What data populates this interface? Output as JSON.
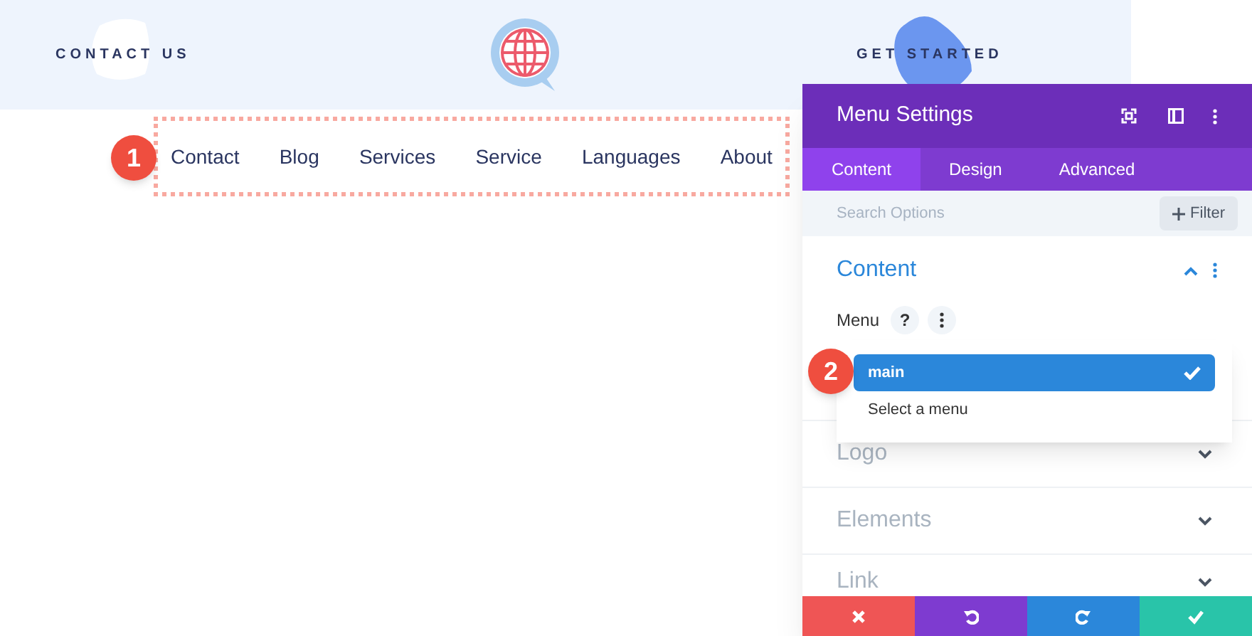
{
  "header": {
    "left_link": "CONTACT US",
    "right_link": "GET STARTED"
  },
  "menu_items": [
    "Contact",
    "Blog",
    "Services",
    "Service",
    "Languages",
    "About"
  ],
  "callouts": [
    "1",
    "2"
  ],
  "panel": {
    "title": "Menu Settings",
    "tabs": [
      {
        "label": "Content",
        "selected": true
      },
      {
        "label": "Design",
        "selected": false
      },
      {
        "label": "Advanced",
        "selected": false
      }
    ],
    "search": {
      "placeholder": "Search Options"
    },
    "filter_button": "Filter",
    "sections": [
      {
        "title": "Content",
        "expanded": true
      },
      {
        "title": "Logo",
        "expanded": false
      },
      {
        "title": "Elements",
        "expanded": false
      },
      {
        "title": "Link",
        "expanded": false
      }
    ],
    "field_label": "Menu",
    "help": "?",
    "options": [
      {
        "label": "main",
        "selected": true
      },
      {
        "label": "Select a menu",
        "selected": false
      }
    ],
    "actions": [
      {
        "kind": "discard"
      },
      {
        "kind": "undo"
      },
      {
        "kind": "redo"
      },
      {
        "kind": "save"
      }
    ]
  }
}
